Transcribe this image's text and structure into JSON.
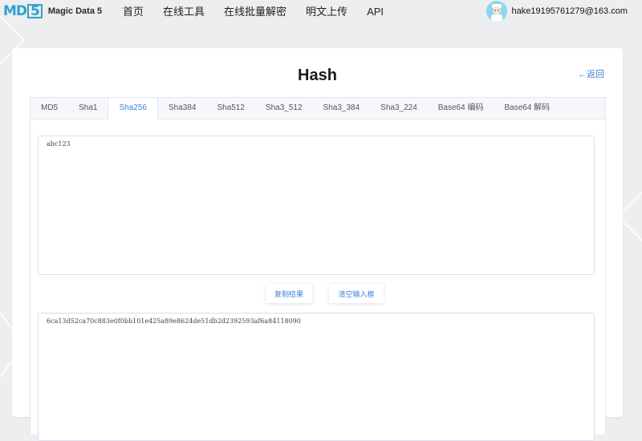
{
  "header": {
    "logo_mark": "MD",
    "logo_mark_box": "5",
    "logo_text": "Magic Data 5",
    "nav": [
      "首页",
      "在线工具",
      "在线批量解密",
      "明文上传",
      "API"
    ],
    "user_email": "hake19195761279@163.com"
  },
  "page": {
    "title": "Hash",
    "back_label": "←返回"
  },
  "tabs": {
    "items": [
      "MD5",
      "Sha1",
      "Sha256",
      "Sha384",
      "Sha512",
      "Sha3_512",
      "Sha3_384",
      "Sha3_224",
      "Base64 编码",
      "Base64 解码"
    ],
    "active": "Sha256"
  },
  "input": {
    "value": "abc123"
  },
  "buttons": {
    "copy_label": "复制结果",
    "clear_label": "清空输入框"
  },
  "output": {
    "value": "6ca13d52ca70c883e0f0bb101e425a89e8624de51db2d2392593af6a84118090"
  },
  "colors": {
    "accent": "#3b84d9",
    "logo": "#2fa3c9",
    "background": "#eceef0"
  }
}
